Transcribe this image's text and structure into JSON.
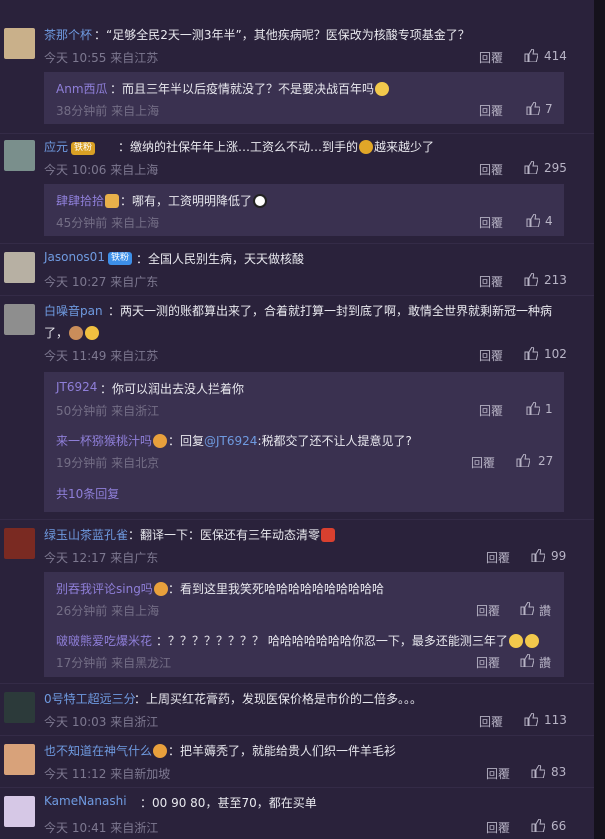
{
  "ui": {
    "reply_label": "回覆",
    "like_praise": "讚",
    "more_replies": "共10条回复"
  },
  "comments": [
    {
      "user": "茶那个杯",
      "text": "：“足够全民2天一测3年半”，其他疾病呢？医保改为核酸专项基金了？",
      "meta": "今天 10:55 来自江苏",
      "likes": "414",
      "avatar_color": "#c9b08a",
      "replies": [
        {
          "user": "Anm西瓜",
          "text": "：而且三年半以后疫情就没了？不是要决战百年吗",
          "meta": "38分钟前 来自上海",
          "likes": "7"
        }
      ]
    },
    {
      "user": "应元",
      "badge": "铁粉",
      "text": "：缴纳的社保年年上涨…工资么不动…到手的",
      "text_tail": "越来越少了",
      "meta": "今天 10:06 来自上海",
      "likes": "295",
      "avatar_color": "#7a8f8c",
      "replies": [
        {
          "user": "肆肆拾拾",
          "text": "：哪有，工资明明降低了",
          "meta": "45分钟前 来自上海",
          "likes": "4"
        }
      ]
    },
    {
      "user": "Jasonos01",
      "badge": "铁粉",
      "text": "：全国人民别生病，天天做核酸",
      "meta": "今天 10:27 来自广东",
      "likes": "213",
      "avatar_color": "#b7b0a3"
    },
    {
      "user": "白噪音pan",
      "text": "：两天一测的账都算出来了，合着就打算一封到底了啊，敢情全世界就剩新冠一种病",
      "text_line2": "了，",
      "meta": "今天 11:49 来自江苏",
      "likes": "102",
      "avatar_color": "#8e8e8e",
      "replies": [
        {
          "user": "JT6924",
          "text": "：你可以润出去没人拦着你",
          "meta": "50分钟前 来自浙江",
          "likes": "1"
        },
        {
          "user": "来一杯猕猴桃汁吗",
          "pre": "：回复",
          "mention": "@JT6924",
          "text": ":税都交了还不让人提意见了?",
          "meta": "19分钟前 来自北京",
          "likes": "27"
        }
      ]
    },
    {
      "user": "绿玉山茶蓝孔雀",
      "text": "：翻译一下：医保还有三年动态清零",
      "meta": "今天 12:17 来自广东",
      "likes": "99",
      "avatar_color": "#7a2a22",
      "replies": [
        {
          "user": "别吞我评论sing吗",
          "text": "：看到这里我笑死哈哈哈哈哈哈哈哈哈哈",
          "meta": "26分钟前 来自上海",
          "likes": "讚"
        },
        {
          "user": "啵啵熊爱吃爆米花",
          "text": "：？？？？？？？？ 哈哈哈哈哈哈哈你忍一下，最多还能测三年了",
          "meta": "17分钟前 来自黑龙江",
          "likes": "讚"
        }
      ]
    },
    {
      "user": "0号特工超远三分",
      "text": "：上周买红花膏药，发现医保价格是市价的二倍多。。。",
      "meta": "今天 10:03 来自浙江",
      "likes": "113",
      "avatar_color": "#2c3a3a"
    },
    {
      "user": "也不知道在神气什么",
      "text": "：把羊薅秃了，就能给贵人们织一件羊毛衫",
      "meta": "今天 11:12 来自新加坡",
      "likes": "83",
      "avatar_color": "#d8a27a"
    },
    {
      "user": "KameNanashi",
      "text": "：00 90 80，甚至70，都在买单",
      "meta": "今天 10:41 来自浙江",
      "likes": "66",
      "avatar_color": "#d6c8e6"
    }
  ],
  "colors": {
    "background": "#2a223b",
    "reply_box": "#3a3150",
    "username": "#6f9ae0",
    "sub_username": "#8f7fd9",
    "meta": "#7d7890"
  }
}
